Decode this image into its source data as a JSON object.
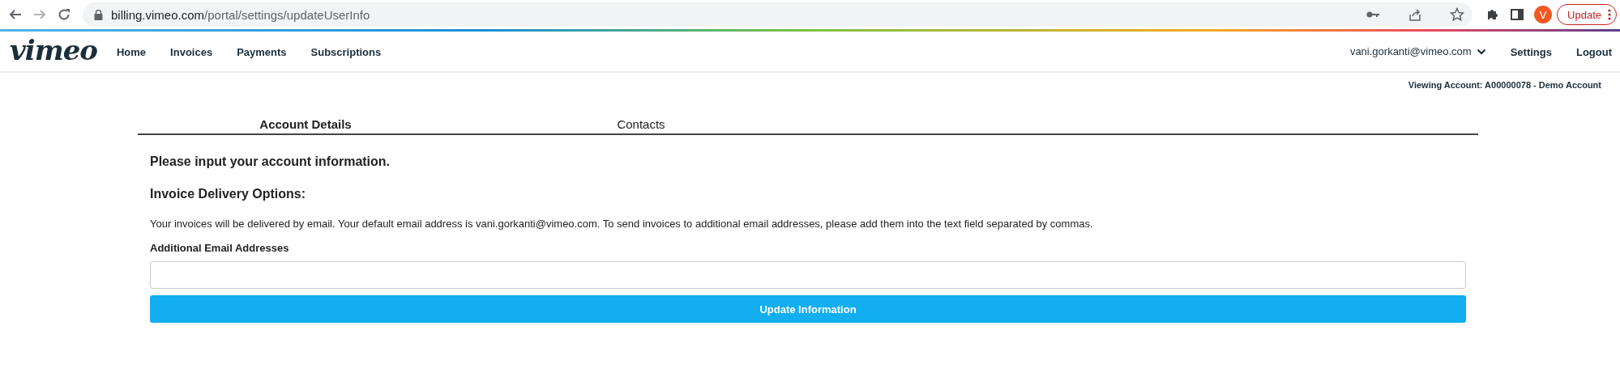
{
  "browser": {
    "url_host": "billing.vimeo.com",
    "url_path": "/portal/settings/updateUserInfo",
    "profile_initial": "V",
    "update_label": "Update"
  },
  "nav": {
    "logo": "vimeo",
    "links": [
      "Home",
      "Invoices",
      "Payments",
      "Subscriptions"
    ],
    "user": "vani.gorkanti@vimeo.com",
    "right_links": [
      "Settings",
      "Logout"
    ]
  },
  "viewing_account": "Viewing Account: A00000078 - Demo Account",
  "tabs": [
    {
      "label": "Account Details",
      "selected": true
    },
    {
      "label": "Contacts",
      "selected": false
    }
  ],
  "form": {
    "heading": "Please input your account information.",
    "subheading": "Invoice Delivery Options:",
    "description": "Your invoices will be delivered by email. Your default email address is vani.gorkanti@vimeo.com. To send invoices to additional email addresses, please add them into the text field separated by commas.",
    "field_label": "Additional Email Addresses",
    "submit": "Update Information"
  }
}
